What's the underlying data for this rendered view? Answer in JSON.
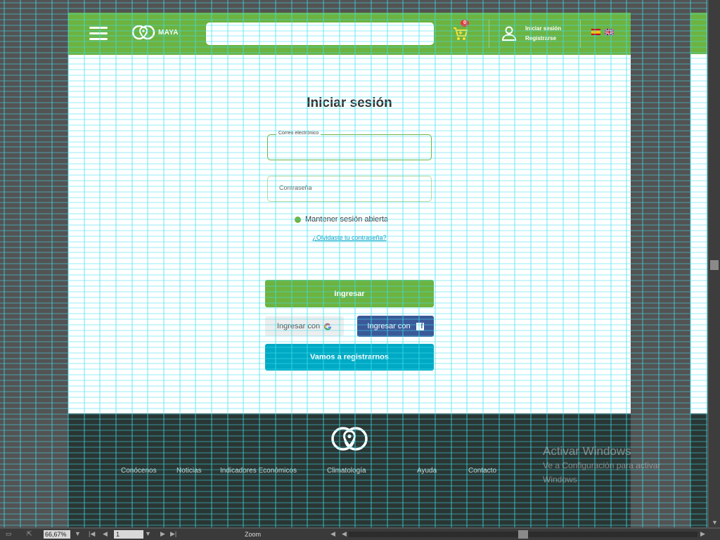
{
  "header": {
    "brand": "MAYA",
    "cart_count": "0",
    "login_link": "Iniciar sesión",
    "register_link": "Registrarse",
    "search_value": ""
  },
  "login": {
    "title": "Iniciar sesión",
    "email_label": "Correo electrónico",
    "password_placeholder": "Contraseña",
    "remember_label": "Mantener sesión abierta",
    "forgot_link": "¿Olvidaste tu contraseña?",
    "submit_label": "Ingresar",
    "google_label": "Ingresar con",
    "facebook_label": "Ingresar con",
    "register_label": "Vamos a registrarnos"
  },
  "footer": {
    "nav": [
      "Conócenos",
      "Noticias",
      "Indicadores Económicos",
      "Climatología",
      "Ayuda",
      "Contacto"
    ]
  },
  "watermark": {
    "title": "Activar Windows",
    "line1": "Ve a Configuración para activar",
    "line2": "Windows"
  },
  "statusbar": {
    "zoom": "66,67%",
    "page": "1",
    "label": "Zoom"
  },
  "colors": {
    "brand_green": "#6db33f",
    "register_blue": "#00a9c4",
    "facebook_blue": "#3b5998",
    "footer_dark": "#2a3633",
    "guide_cyan": "#40e0f0"
  },
  "icons": [
    "menu-icon",
    "location-logo-icon",
    "cart-icon",
    "user-icon",
    "spain-flag-icon",
    "uk-flag-icon",
    "google-icon",
    "facebook-icon"
  ]
}
